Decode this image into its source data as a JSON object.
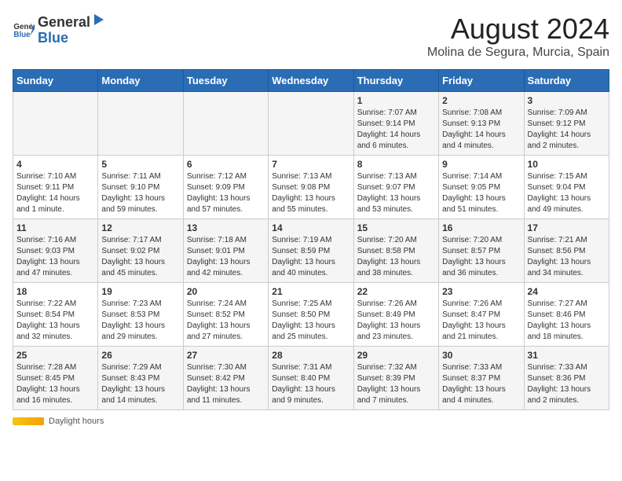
{
  "header": {
    "logo_general": "General",
    "logo_blue": "Blue",
    "title": "August 2024",
    "subtitle": "Molina de Segura, Murcia, Spain"
  },
  "days_of_week": [
    "Sunday",
    "Monday",
    "Tuesday",
    "Wednesday",
    "Thursday",
    "Friday",
    "Saturday"
  ],
  "weeks": [
    [
      {
        "day": "",
        "info": ""
      },
      {
        "day": "",
        "info": ""
      },
      {
        "day": "",
        "info": ""
      },
      {
        "day": "",
        "info": ""
      },
      {
        "day": "1",
        "info": "Sunrise: 7:07 AM\nSunset: 9:14 PM\nDaylight: 14 hours and 6 minutes."
      },
      {
        "day": "2",
        "info": "Sunrise: 7:08 AM\nSunset: 9:13 PM\nDaylight: 14 hours and 4 minutes."
      },
      {
        "day": "3",
        "info": "Sunrise: 7:09 AM\nSunset: 9:12 PM\nDaylight: 14 hours and 2 minutes."
      }
    ],
    [
      {
        "day": "4",
        "info": "Sunrise: 7:10 AM\nSunset: 9:11 PM\nDaylight: 14 hours and 1 minute."
      },
      {
        "day": "5",
        "info": "Sunrise: 7:11 AM\nSunset: 9:10 PM\nDaylight: 13 hours and 59 minutes."
      },
      {
        "day": "6",
        "info": "Sunrise: 7:12 AM\nSunset: 9:09 PM\nDaylight: 13 hours and 57 minutes."
      },
      {
        "day": "7",
        "info": "Sunrise: 7:13 AM\nSunset: 9:08 PM\nDaylight: 13 hours and 55 minutes."
      },
      {
        "day": "8",
        "info": "Sunrise: 7:13 AM\nSunset: 9:07 PM\nDaylight: 13 hours and 53 minutes."
      },
      {
        "day": "9",
        "info": "Sunrise: 7:14 AM\nSunset: 9:05 PM\nDaylight: 13 hours and 51 minutes."
      },
      {
        "day": "10",
        "info": "Sunrise: 7:15 AM\nSunset: 9:04 PM\nDaylight: 13 hours and 49 minutes."
      }
    ],
    [
      {
        "day": "11",
        "info": "Sunrise: 7:16 AM\nSunset: 9:03 PM\nDaylight: 13 hours and 47 minutes."
      },
      {
        "day": "12",
        "info": "Sunrise: 7:17 AM\nSunset: 9:02 PM\nDaylight: 13 hours and 45 minutes."
      },
      {
        "day": "13",
        "info": "Sunrise: 7:18 AM\nSunset: 9:01 PM\nDaylight: 13 hours and 42 minutes."
      },
      {
        "day": "14",
        "info": "Sunrise: 7:19 AM\nSunset: 8:59 PM\nDaylight: 13 hours and 40 minutes."
      },
      {
        "day": "15",
        "info": "Sunrise: 7:20 AM\nSunset: 8:58 PM\nDaylight: 13 hours and 38 minutes."
      },
      {
        "day": "16",
        "info": "Sunrise: 7:20 AM\nSunset: 8:57 PM\nDaylight: 13 hours and 36 minutes."
      },
      {
        "day": "17",
        "info": "Sunrise: 7:21 AM\nSunset: 8:56 PM\nDaylight: 13 hours and 34 minutes."
      }
    ],
    [
      {
        "day": "18",
        "info": "Sunrise: 7:22 AM\nSunset: 8:54 PM\nDaylight: 13 hours and 32 minutes."
      },
      {
        "day": "19",
        "info": "Sunrise: 7:23 AM\nSunset: 8:53 PM\nDaylight: 13 hours and 29 minutes."
      },
      {
        "day": "20",
        "info": "Sunrise: 7:24 AM\nSunset: 8:52 PM\nDaylight: 13 hours and 27 minutes."
      },
      {
        "day": "21",
        "info": "Sunrise: 7:25 AM\nSunset: 8:50 PM\nDaylight: 13 hours and 25 minutes."
      },
      {
        "day": "22",
        "info": "Sunrise: 7:26 AM\nSunset: 8:49 PM\nDaylight: 13 hours and 23 minutes."
      },
      {
        "day": "23",
        "info": "Sunrise: 7:26 AM\nSunset: 8:47 PM\nDaylight: 13 hours and 21 minutes."
      },
      {
        "day": "24",
        "info": "Sunrise: 7:27 AM\nSunset: 8:46 PM\nDaylight: 13 hours and 18 minutes."
      }
    ],
    [
      {
        "day": "25",
        "info": "Sunrise: 7:28 AM\nSunset: 8:45 PM\nDaylight: 13 hours and 16 minutes."
      },
      {
        "day": "26",
        "info": "Sunrise: 7:29 AM\nSunset: 8:43 PM\nDaylight: 13 hours and 14 minutes."
      },
      {
        "day": "27",
        "info": "Sunrise: 7:30 AM\nSunset: 8:42 PM\nDaylight: 13 hours and 11 minutes."
      },
      {
        "day": "28",
        "info": "Sunrise: 7:31 AM\nSunset: 8:40 PM\nDaylight: 13 hours and 9 minutes."
      },
      {
        "day": "29",
        "info": "Sunrise: 7:32 AM\nSunset: 8:39 PM\nDaylight: 13 hours and 7 minutes."
      },
      {
        "day": "30",
        "info": "Sunrise: 7:33 AM\nSunset: 8:37 PM\nDaylight: 13 hours and 4 minutes."
      },
      {
        "day": "31",
        "info": "Sunrise: 7:33 AM\nSunset: 8:36 PM\nDaylight: 13 hours and 2 minutes."
      }
    ]
  ],
  "footer": {
    "daylight_label": "Daylight hours"
  }
}
